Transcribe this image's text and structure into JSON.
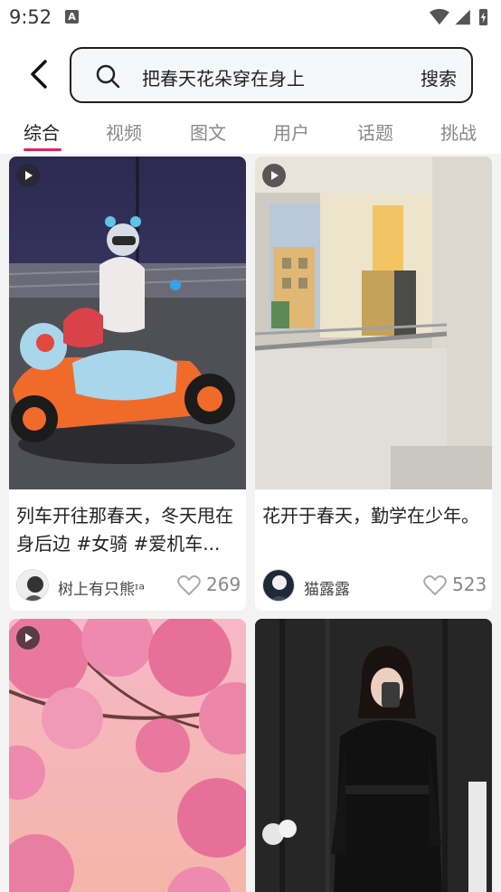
{
  "status_bar": {
    "time": "9:52",
    "notification_icon_letter": "A"
  },
  "search": {
    "query": "把春天花朵穿在身上",
    "submit_label": "搜索"
  },
  "tabs": [
    {
      "label": "综合",
      "active": true
    },
    {
      "label": "视频",
      "active": false
    },
    {
      "label": "图文",
      "active": false
    },
    {
      "label": "用户",
      "active": false
    },
    {
      "label": "话题",
      "active": false
    },
    {
      "label": "挑战",
      "active": false
    }
  ],
  "colors": {
    "accent": "#e0245e",
    "background": "#f3f3f3"
  },
  "cards": [
    {
      "title": "列车开往那春天，冬天甩在身后边 #女骑 #爱机车...",
      "author": "树上有只熊ᶦᵃ",
      "likes": "269",
      "has_video": true
    },
    {
      "title": "花开于春天，勤学在少年。",
      "author": "猫露露",
      "likes": "523",
      "has_video": true
    },
    {
      "title": "",
      "author": "",
      "likes": "",
      "has_video": true
    },
    {
      "title": "",
      "author": "",
      "likes": "",
      "has_video": false
    }
  ]
}
